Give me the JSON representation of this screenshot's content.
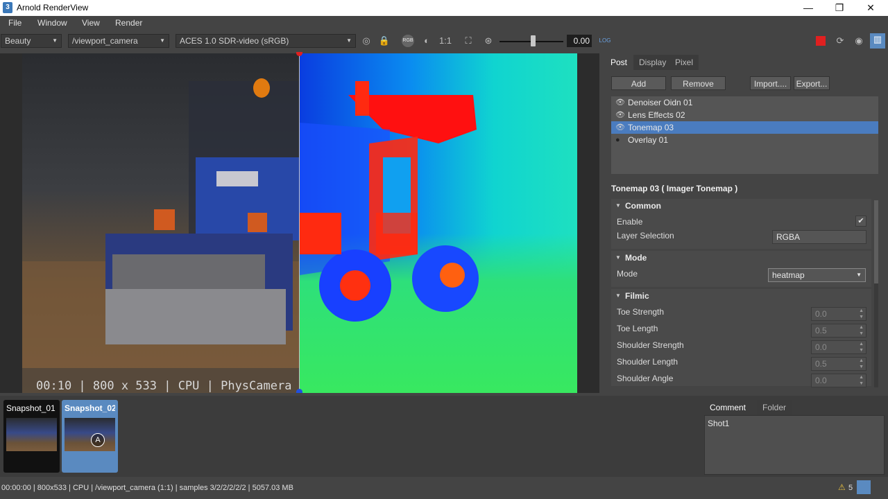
{
  "window": {
    "title": "Arnold RenderView",
    "icon_text": "3",
    "minimize": "—",
    "maximize": "❐",
    "close": "✕"
  },
  "menu": [
    "File",
    "Window",
    "View",
    "Render"
  ],
  "toolbar": {
    "aov": "Beauty",
    "camera": "/viewport_camera",
    "view_transform": "ACES 1.0 SDR-video (sRGB)",
    "rgb_label": "RGB",
    "ratio": "1:1",
    "exposure_value": "0.00",
    "exposure_level": 0.5,
    "log_label": "LOG"
  },
  "viewport": {
    "overlay_text": "00:10 | 800 x 533 | CPU | PhysCamera"
  },
  "panel": {
    "tabs": [
      "Post",
      "Display",
      "Pixel"
    ],
    "buttons": {
      "add": "Add",
      "remove": "Remove",
      "import": "Import....",
      "export": "Export..."
    },
    "imagers": [
      {
        "name": "Denoiser Oidn 01",
        "visible": true,
        "selected": false
      },
      {
        "name": "Lens Effects 02",
        "visible": true,
        "selected": false
      },
      {
        "name": "Tonemap 03",
        "visible": true,
        "selected": true
      },
      {
        "name": "Overlay 01",
        "visible": false,
        "selected": false
      }
    ],
    "prop_title": "Tonemap 03  ( Imager Tonemap )",
    "sections": {
      "common": "Common",
      "mode": "Mode",
      "filmic": "Filmic"
    },
    "common": {
      "enable_label": "Enable",
      "enable_checked": true,
      "layer_label": "Layer Selection",
      "layer_value": "RGBA"
    },
    "mode": {
      "mode_label": "Mode",
      "mode_value": "heatmap"
    },
    "filmic": {
      "toe_strength_label": "Toe Strength",
      "toe_strength_value": "0.0",
      "toe_length_label": "Toe Length",
      "toe_length_value": "0.5",
      "shoulder_strength_label": "Shoulder Strength",
      "shoulder_strength_value": "0.0",
      "shoulder_length_label": "Shoulder Length",
      "shoulder_length_value": "0.5",
      "shoulder_angle_label": "Shoulder Angle",
      "shoulder_angle_value": "0.0"
    }
  },
  "snapshots": [
    {
      "label": "Snapshot_01",
      "selected": false
    },
    {
      "label": "Snapshot_02",
      "selected": true
    }
  ],
  "comment": {
    "tabs": [
      "Comment",
      "Folder"
    ],
    "text": "Shot1"
  },
  "status": {
    "text": "00:00:00 | 800x533 | CPU | /viewport_camera (1:1) | samples 3/2/2/2/2/2 | 5057.03 MB",
    "warnings": "5"
  },
  "colors": {
    "selection": "#4a7cbf",
    "stop_button": "#e02020",
    "compare_top": "#e02020",
    "compare_bottom": "#2050e0"
  }
}
